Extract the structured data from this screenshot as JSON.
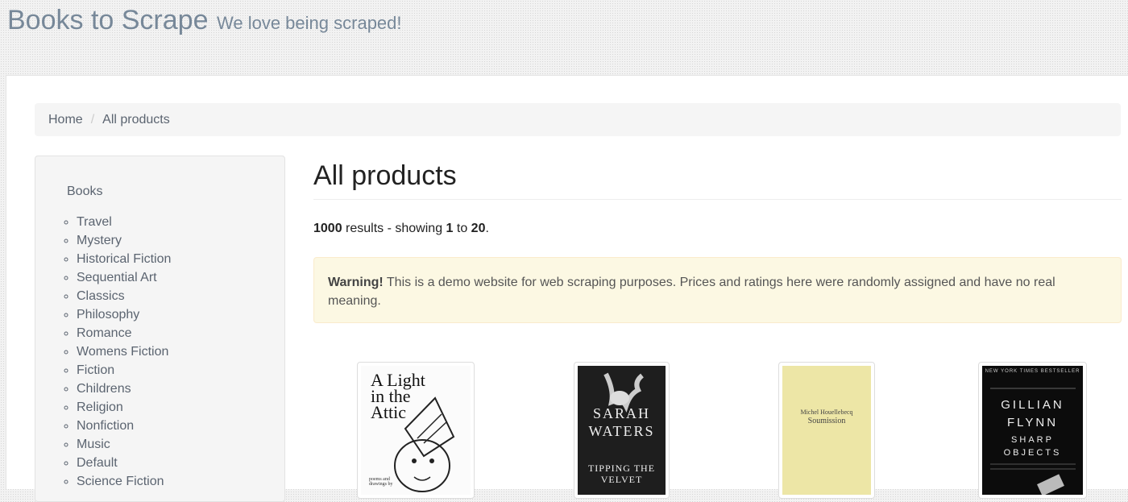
{
  "header": {
    "brand": "Books to Scrape",
    "tagline": "We love being scraped!"
  },
  "breadcrumb": {
    "home": "Home",
    "separator": "/",
    "current": "All products"
  },
  "sidebar": {
    "title": "Books",
    "categories": [
      "Travel",
      "Mystery",
      "Historical Fiction",
      "Sequential Art",
      "Classics",
      "Philosophy",
      "Romance",
      "Womens Fiction",
      "Fiction",
      "Childrens",
      "Religion",
      "Nonfiction",
      "Music",
      "Default",
      "Science Fiction"
    ]
  },
  "main": {
    "title": "All products",
    "results": {
      "total": "1000",
      "text_mid": " results - showing ",
      "from": "1",
      "to_word": " to ",
      "to": "20",
      "end": "."
    },
    "alert": {
      "strong": "Warning!",
      "text": " This is a demo website for web scraping purposes. Prices and ratings here were randomly assigned and have no real meaning."
    }
  },
  "products": [
    {
      "cover_lines": [
        "A Light",
        "in the",
        "Attic"
      ],
      "cover_small": "poems and drawings by"
    },
    {
      "cover_lines": [
        "SARAH",
        "WATERS"
      ],
      "cover_small": "TIPPING THE VELVET"
    },
    {
      "cover_lines": [
        "Michel Houellebecq",
        "Soumission"
      ],
      "cover_small": ""
    },
    {
      "cover_lines": [
        "GILLIAN",
        "FLYNN",
        "SHARP",
        "OBJECTS"
      ],
      "cover_small": "NEW YORK TIMES BESTSELLER"
    }
  ],
  "colors": {
    "brand": "#778899",
    "alert_bg": "#fcf8e3",
    "alert_border": "#faebcc"
  }
}
